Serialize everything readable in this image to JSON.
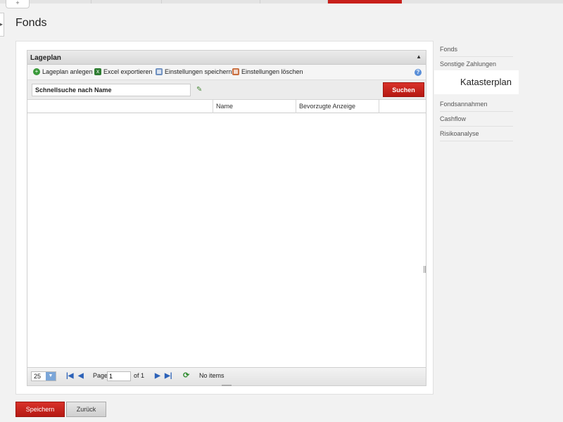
{
  "top": {
    "tab_icon": "+"
  },
  "page": {
    "title": "Fonds"
  },
  "grid": {
    "title": "Lageplan",
    "toolbar": {
      "add": "Lageplan anlegen",
      "excel": "Excel exportieren",
      "save_settings": "Einstellungen speichern",
      "delete_settings": "Einstellungen löschen"
    },
    "search": {
      "value": "Schnellsuche nach Name",
      "button": "Suchen"
    },
    "columns": [
      "",
      "Name",
      "Bevorzugte Anzeige",
      ""
    ],
    "pager": {
      "page_size": "25",
      "page_label": "Page",
      "page_value": "1",
      "of_label": "of 1",
      "status": "No items"
    }
  },
  "sidenav": {
    "items": [
      "Fonds",
      "Sonstige Zahlungen",
      "Fondsannahmen",
      "Cashflow",
      "Risikoanalyse"
    ],
    "active": "Katasterplan"
  },
  "actions": {
    "save": "Speichern",
    "back": "Zurück"
  },
  "colors": {
    "accent": "#c8201b",
    "link": "#2d62b8"
  }
}
